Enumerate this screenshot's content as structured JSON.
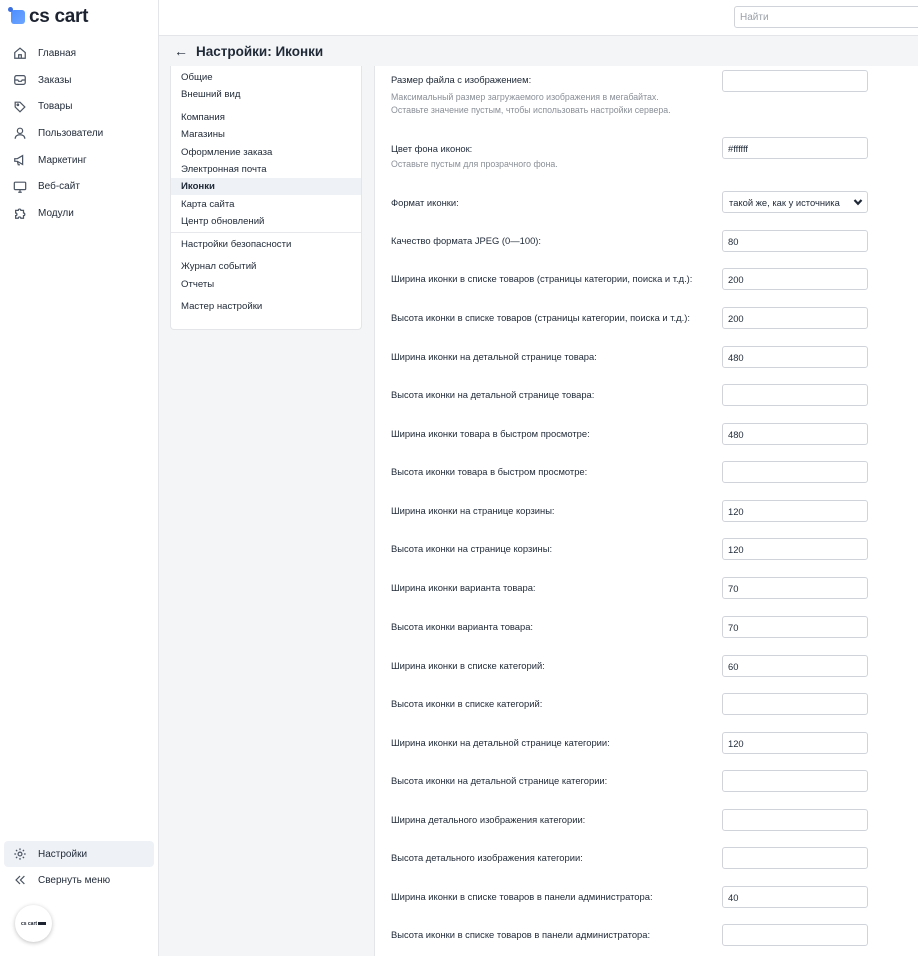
{
  "app": {
    "logo_text": "cs cart",
    "avatar_label": "cs cart"
  },
  "header": {
    "search_placeholder": "Найти"
  },
  "page": {
    "title": "Настройки: Иконки"
  },
  "sidebar": {
    "items": [
      {
        "label": "Главная",
        "icon": "home-icon"
      },
      {
        "label": "Заказы",
        "icon": "inbox-icon"
      },
      {
        "label": "Товары",
        "icon": "tag-icon"
      },
      {
        "label": "Пользователи",
        "icon": "user-icon"
      },
      {
        "label": "Маркетинг",
        "icon": "megaphone-icon"
      },
      {
        "label": "Веб-сайт",
        "icon": "monitor-icon"
      },
      {
        "label": "Модули",
        "icon": "puzzle-icon"
      }
    ],
    "bottom": [
      {
        "label": "Настройки",
        "icon": "gear-icon",
        "active": true
      },
      {
        "label": "Свернуть меню",
        "icon": "collapse-icon"
      }
    ]
  },
  "submenu": {
    "items": [
      "Общие",
      "Внешний вид",
      "Компания",
      "Магазины",
      "Оформление заказа",
      "Электронная почта",
      "Иконки",
      "Карта сайта",
      "Центр обновлений",
      "Настройки безопасности",
      "Журнал событий",
      "Отчеты",
      "Мастер настройки"
    ],
    "active": "Иконки"
  },
  "settings": {
    "rows": [
      {
        "label": "Размер файла с изображением:",
        "help": [
          "Максимальный размер загружаемого изображения в мегабайтах.",
          "Оставьте значение пустым, чтобы использовать настройки сервера."
        ],
        "value": ""
      },
      {
        "label": "Цвет фона иконок:",
        "help": [
          "Оставьте пустым для прозрачного фона."
        ],
        "value": "#ffffff"
      },
      {
        "label": "Формат иконки:",
        "value": "такой же, как у источника",
        "type": "select"
      },
      {
        "label": "Качество формата JPEG (0—100):",
        "value": "80"
      },
      {
        "label": "Ширина иконки в списке товаров (страницы категории, поиска и т.д.):",
        "value": "200"
      },
      {
        "label": "Высота иконки в списке товаров (страницы категории, поиска и т.д.):",
        "value": "200"
      },
      {
        "label": "Ширина иконки на детальной странице товара:",
        "value": "480"
      },
      {
        "label": "Высота иконки на детальной странице товара:",
        "value": ""
      },
      {
        "label": "Ширина иконки товара в быстром просмотре:",
        "value": "480"
      },
      {
        "label": "Высота иконки товара в быстром просмотре:",
        "value": ""
      },
      {
        "label": "Ширина иконки на странице корзины:",
        "value": "120"
      },
      {
        "label": "Высота иконки на странице корзины:",
        "value": "120"
      },
      {
        "label": "Ширина иконки варианта товара:",
        "value": "70"
      },
      {
        "label": "Высота иконки варианта товара:",
        "value": "70"
      },
      {
        "label": "Ширина иконки в списке категорий:",
        "value": "60"
      },
      {
        "label": "Высота иконки в списке категорий:",
        "value": ""
      },
      {
        "label": "Ширина иконки на детальной странице категории:",
        "value": "120"
      },
      {
        "label": "Высота иконки на детальной странице категории:",
        "value": ""
      },
      {
        "label": "Ширина детального изображения категории:",
        "value": ""
      },
      {
        "label": "Высота детального изображения категории:",
        "value": ""
      },
      {
        "label": "Ширина иконки в списке товаров в панели администратора:",
        "value": "40"
      },
      {
        "label": "Высота иконки в списке товаров в панели администратора:",
        "value": ""
      }
    ]
  }
}
